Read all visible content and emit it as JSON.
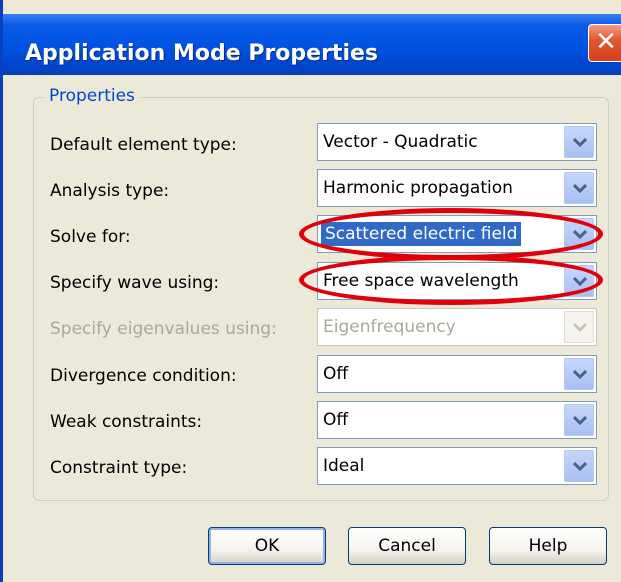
{
  "window": {
    "title": "Application Mode Properties",
    "close_glyph": "✕"
  },
  "properties": {
    "group_label": "Properties",
    "rows": [
      {
        "label": "Default element type:",
        "value": "Vector - Quadratic",
        "enabled": true
      },
      {
        "label": "Analysis type:",
        "value": "Harmonic propagation",
        "enabled": true
      },
      {
        "label": "Solve for:",
        "value": "Scattered electric field",
        "enabled": true,
        "selected": true
      },
      {
        "label": "Specify wave using:",
        "value": "Free space wavelength",
        "enabled": true
      },
      {
        "label": "Specify eigenvalues using:",
        "value": "Eigenfrequency",
        "enabled": false
      },
      {
        "label": "Divergence condition:",
        "value": "Off",
        "enabled": true
      },
      {
        "label": "Weak constraints:",
        "value": "Off",
        "enabled": true
      },
      {
        "label": "Constraint type:",
        "value": "Ideal",
        "enabled": true
      }
    ]
  },
  "buttons": {
    "ok": "OK",
    "cancel": "Cancel",
    "help": "Help"
  },
  "colors": {
    "titlebar": "#0054e3",
    "group_label": "#0046d5",
    "annotation": "#e0000c",
    "selection": "#316ac5"
  },
  "icons": {
    "close": "close-icon",
    "dropdown": "chevron-down-icon"
  }
}
